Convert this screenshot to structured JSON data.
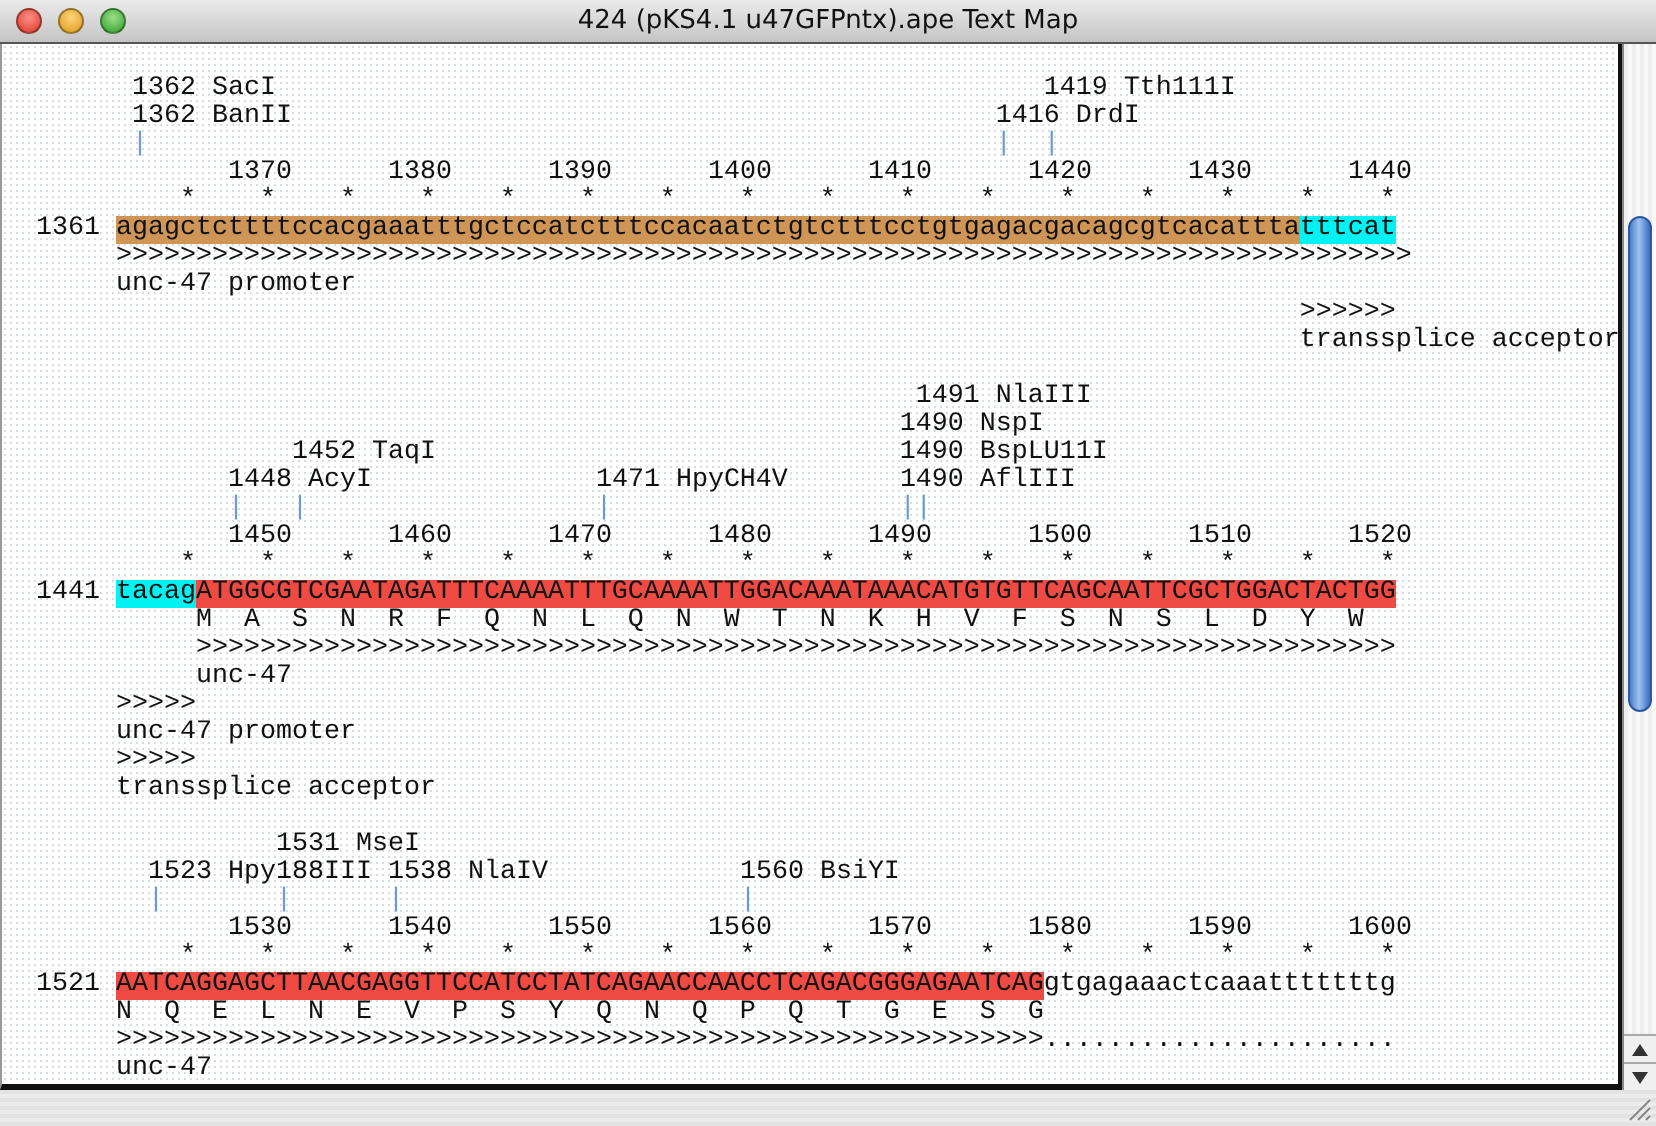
{
  "window": {
    "title": "424 (pKS4.1 u47GFPntx).ape Text Map"
  },
  "blocks": [
    {
      "lines": [
        {
          "kind": "sites",
          "parts": [
            "      1362 SacI",
            "                                                1419 Tth111I"
          ]
        },
        {
          "kind": "sites",
          "parts": [
            "      1362 BanII",
            "                                            1416 DrdI"
          ]
        },
        {
          "kind": "ticks",
          "parts": [
            "      |",
            "                                                     |",
            "  |"
          ]
        },
        {
          "kind": "ruler",
          "parts": [
            "            1370",
            "      1380",
            "      1390",
            "      1400",
            "      1410",
            "      1420",
            "      1430",
            "      1440"
          ]
        },
        {
          "kind": "stars",
          "parts": [
            "         *    *    *    *    *    *    *    *    *    *    *    *    *    *    *    *"
          ]
        },
        {
          "kind": "sequence",
          "number": "1361",
          "parts": [
            {
              "text": "agagctcttttccacgaaatttgctccatctttccacaatctgtctttcctgtgagacgacagcgtcacattta",
              "color": "#cf9556"
            },
            {
              "text": "tttcat",
              "color": "#00f2f2"
            }
          ]
        },
        {
          "kind": "arrow",
          "parts": [
            "     >>>>>>>>>>>>>>>>>>>>>>>>>>>>>>>>>>>>>>>>>>>>>>>>>>>>>>>>>>>>>>>>>>>>>>>>>>>>>>>>>"
          ]
        },
        {
          "kind": "label",
          "parts": [
            "     unc-47 promoter"
          ]
        },
        {
          "kind": "arrow",
          "parts": [
            "                                                                               >>>>>>"
          ]
        },
        {
          "kind": "label",
          "parts": [
            "                                                                               transsplice acceptor"
          ]
        }
      ]
    },
    {
      "lines": [
        {
          "kind": "sites",
          "parts": [
            "                                                       1491 NlaIII"
          ]
        },
        {
          "kind": "sites",
          "parts": [
            "                                                      1490 NspI"
          ]
        },
        {
          "kind": "sites",
          "parts": [
            "                1452 TaqI",
            "                             1490 BspLU11I"
          ]
        },
        {
          "kind": "sites",
          "parts": [
            "            1448 AcyI",
            "              1471 HpyCH4V",
            "       1490 AflIII"
          ]
        },
        {
          "kind": "ticks",
          "parts": [
            "            |",
            "   |",
            "                  |",
            "                  |",
            "|"
          ]
        },
        {
          "kind": "ruler",
          "parts": [
            "            1450",
            "      1460",
            "      1470",
            "      1480",
            "      1490",
            "      1500",
            "      1510",
            "      1520"
          ]
        },
        {
          "kind": "stars",
          "parts": [
            "         *    *    *    *    *    *    *    *    *    *    *    *    *    *    *    *"
          ]
        },
        {
          "kind": "sequence",
          "number": "1441",
          "parts": [
            {
              "text": "tacag",
              "color": "#00f2f2"
            },
            {
              "text": "ATGGCGTCGAATAGATTTCAAAATTTGCAAAATTGGACAAATAAACATGTGTTCAGCAATTCGCTGGACTACTGG",
              "color": "#ef4b43"
            }
          ]
        },
        {
          "kind": "translation",
          "parts": [
            "          M  A  S  N  R  F  Q  N  L  Q  N  W  T  N  K  H  V  F  S  N  S  L  D  Y  W"
          ]
        },
        {
          "kind": "arrow",
          "parts": [
            "          >>>>>>>>>>>>>>>>>>>>>>>>>>>>>>>>>>>>>>>>>>>>>>>>>>>>>>>>>>>>>>>>>>>>>>>>>>>"
          ]
        },
        {
          "kind": "label",
          "parts": [
            "          unc-47"
          ]
        },
        {
          "kind": "arrow",
          "parts": [
            "     >>>>>"
          ]
        },
        {
          "kind": "label",
          "parts": [
            "     unc-47 promoter"
          ]
        },
        {
          "kind": "arrow",
          "parts": [
            "     >>>>>"
          ]
        },
        {
          "kind": "label",
          "parts": [
            "     transsplice acceptor"
          ]
        }
      ]
    },
    {
      "lines": [
        {
          "kind": "sites",
          "parts": [
            "               1531 MseI"
          ]
        },
        {
          "kind": "sites",
          "parts": [
            "       1523 Hpy188III",
            " 1538 NlaIV",
            "            1560 BsiYI"
          ]
        },
        {
          "kind": "ticks",
          "parts": [
            "       |",
            "       |",
            "      |",
            "                     |"
          ]
        },
        {
          "kind": "ruler",
          "parts": [
            "            1530",
            "      1540",
            "      1550",
            "      1560",
            "      1570",
            "      1580",
            "      1590",
            "      1600"
          ]
        },
        {
          "kind": "stars",
          "parts": [
            "         *    *    *    *    *    *    *    *    *    *    *    *    *    *    *    *"
          ]
        },
        {
          "kind": "sequence",
          "number": "1521",
          "parts": [
            {
              "text": "AATCAGGAGCTTAACGAGGTTCCATCCTATCAGAACCAACCTCAGACGGGAGAATCAG",
              "color": "#ef4b43"
            },
            {
              "text": "gtgagaaactcaaatttttttg"
            }
          ]
        },
        {
          "kind": "translation",
          "parts": [
            "     N  Q  E  L  N  E  V  P  S  Y  Q  N  Q  P  Q  T  G  E  S  G"
          ]
        },
        {
          "kind": "arrow",
          "parts": [
            "     >>>>>>>>>>>>>>>>>>>>>>>>>>>>>>>>>>>>>>>>>>>>>>>>>>>>>>>>>>",
            "......................"
          ]
        },
        {
          "kind": "label",
          "parts": [
            "     unc-47"
          ]
        }
      ]
    }
  ]
}
